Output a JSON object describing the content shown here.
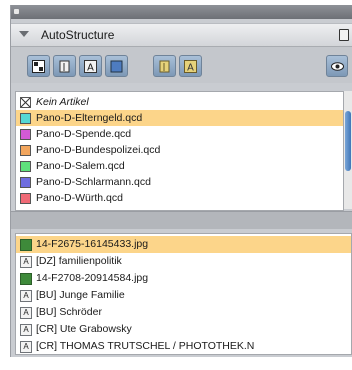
{
  "panel": {
    "title": "AutoStructure"
  },
  "toolbar": {
    "buttons": [
      {
        "icon": "structure-icon"
      },
      {
        "icon": "paragraph-icon"
      },
      {
        "icon": "text-a-icon"
      },
      {
        "icon": "image-icon"
      },
      {
        "icon": "paragraph-color-icon"
      },
      {
        "icon": "text-color-icon"
      },
      {
        "icon": "eye-icon"
      }
    ]
  },
  "articles": [
    {
      "label": "Kein Artikel",
      "color": "#ffffff",
      "italic": true,
      "selected": false
    },
    {
      "label": "Pano-D-Elterngeld.qcd",
      "color": "#56d8d4",
      "selected": true
    },
    {
      "label": "Pano-D-Spende.qcd",
      "color": "#d35ad6",
      "selected": false
    },
    {
      "label": "Pano-D-Bundespolizei.qcd",
      "color": "#f2a65e",
      "selected": false
    },
    {
      "label": "Pano-D-Salem.qcd",
      "color": "#5fe07c",
      "selected": false
    },
    {
      "label": "Pano-D-Schlarmann.qcd",
      "color": "#6f6ee0",
      "selected": false
    },
    {
      "label": "Pano-D-Würth.qcd",
      "color": "#f06a76",
      "selected": false
    }
  ],
  "elements": [
    {
      "label": "14-F2675-16145433.jpg",
      "type": "image",
      "selected": true
    },
    {
      "label": "[DZ] familienpolitik",
      "type": "text",
      "selected": false
    },
    {
      "label": "14-F2708-20914584.jpg",
      "type": "image",
      "selected": false
    },
    {
      "label": "[BU] Junge Familie",
      "type": "text",
      "selected": false
    },
    {
      "label": "[BU] Schröder",
      "type": "text",
      "selected": false
    },
    {
      "label": "[CR] Ute Grabowsky",
      "type": "text",
      "selected": false
    },
    {
      "label": "[CR] THOMAS TRUTSCHEL / PHOTOTHEK.N",
      "type": "text",
      "selected": false
    }
  ]
}
